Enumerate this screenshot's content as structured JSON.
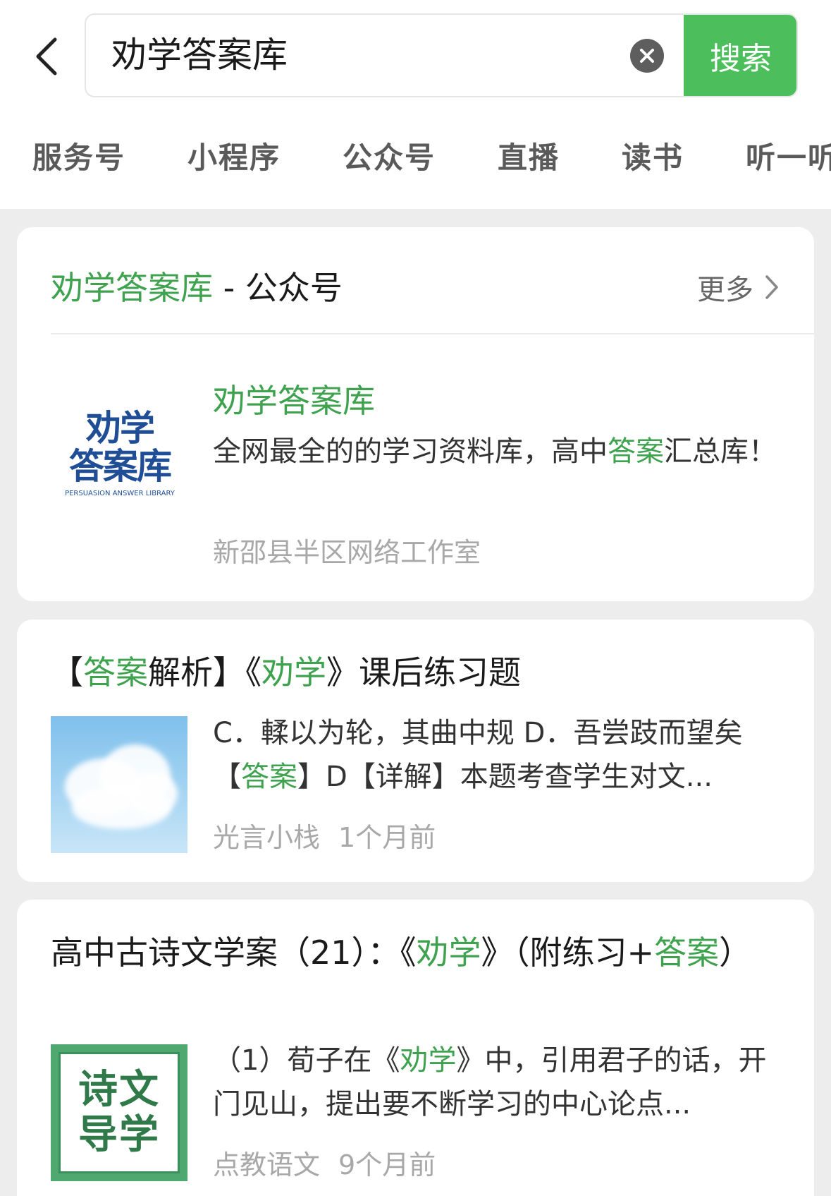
{
  "header": {
    "search_value": "劝学答案库",
    "search_button": "搜索",
    "back_icon": "chevron-left-icon",
    "clear_icon": "close-circle-icon"
  },
  "tabs": [
    "服务号",
    "小程序",
    "公众号",
    "直播",
    "读书",
    "听一听"
  ],
  "account_section": {
    "title_highlight": "劝学答案库",
    "title_rest": " - 公众号",
    "more_label": "更多",
    "account": {
      "logo_line1": "劝学",
      "logo_line2": "答案库",
      "logo_sub": "PERSUASION ANSWER LIBRARY",
      "name": "劝学答案库",
      "desc_before": "全网最全的的学习资料库，高中",
      "desc_highlight": "答案",
      "desc_after": "汇总库！",
      "owner": "新邵县半区网络工作室"
    }
  },
  "articles": [
    {
      "title_parts": [
        "【",
        "答案",
        "解析】《",
        "劝学",
        "》课后练习题"
      ],
      "snippet_parts": [
        "C．輮以为轮，其曲中规 D．吾尝跂而望矣【",
        "答案",
        "】D【详解】本题考查学生对文..."
      ],
      "source": "光言小栈",
      "time": "1个月前"
    },
    {
      "title_parts": [
        "高中古诗文学案（21）：《",
        "劝学",
        "》（附练习+",
        "答案",
        "）"
      ],
      "snippet_parts": [
        "（1）荀子在《",
        "劝学",
        "》中，引用君子的话，开门见山，提出要不断学习的中心论点..."
      ],
      "thumb_line1": "诗文",
      "thumb_line2": "导学",
      "source": "点教语文",
      "time": "9个月前"
    }
  ],
  "colors": {
    "accent_green": "#3fa24f",
    "search_button": "#4cbf5c",
    "background": "#ededed"
  }
}
